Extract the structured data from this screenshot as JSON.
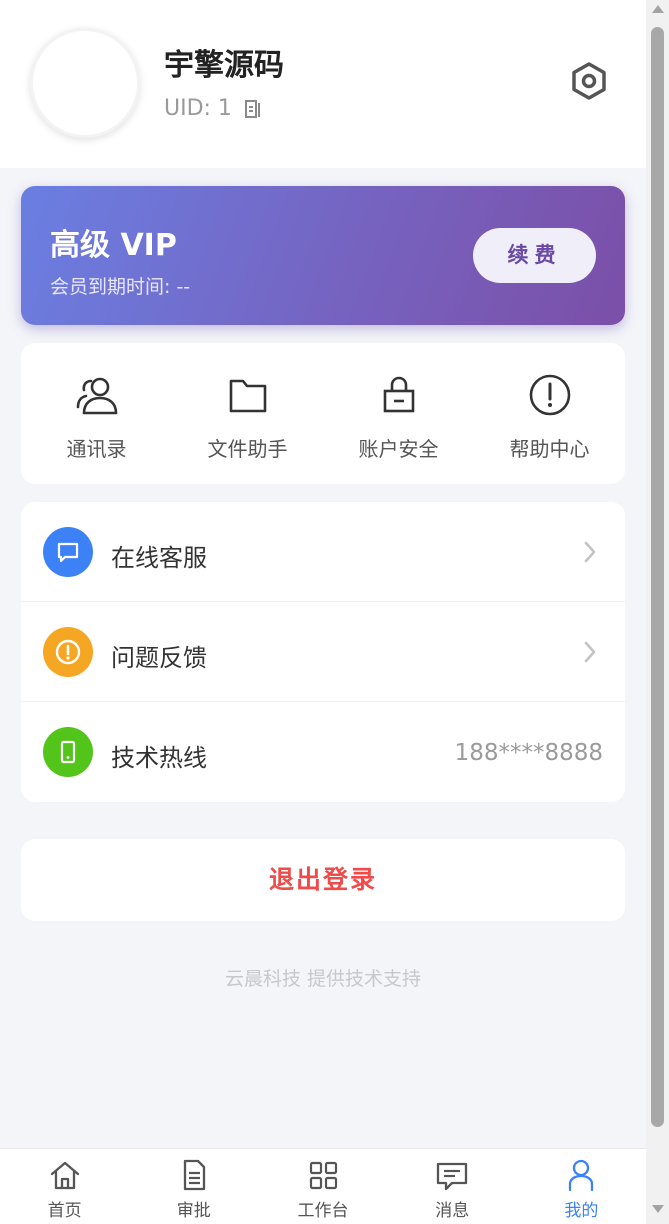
{
  "profile": {
    "name": "宇擎源码",
    "uid": "UID: 1"
  },
  "vip": {
    "title": "高级 VIP",
    "expire": "会员到期时间: --",
    "renew_label": "续费"
  },
  "quick_actions": [
    {
      "label": "通讯录",
      "icon": "contacts-icon"
    },
    {
      "label": "文件助手",
      "icon": "folder-icon"
    },
    {
      "label": "账户安全",
      "icon": "lock-icon"
    },
    {
      "label": "帮助中心",
      "icon": "help-icon"
    }
  ],
  "menu": [
    {
      "label": "在线客服",
      "icon": "chat-icon",
      "color": "#3c82f6"
    },
    {
      "label": "问题反馈",
      "icon": "alert-icon",
      "color": "#f5a623"
    },
    {
      "label": "技术热线",
      "icon": "phone-icon",
      "color": "#52c41a",
      "value": "188****8888"
    }
  ],
  "logout_label": "退出登录",
  "footer": "云晨科技 提供技术支持",
  "tabs": [
    {
      "label": "首页",
      "icon": "home-icon"
    },
    {
      "label": "审批",
      "icon": "document-icon"
    },
    {
      "label": "工作台",
      "icon": "grid-icon"
    },
    {
      "label": "消息",
      "icon": "message-icon"
    },
    {
      "label": "我的",
      "icon": "user-icon",
      "active": true
    }
  ],
  "colors": {
    "accent": "#3c82f6",
    "danger": "#ef4b4b",
    "vip_gradient_start": "#6a7fe2",
    "vip_gradient_end": "#7b4fa7"
  }
}
